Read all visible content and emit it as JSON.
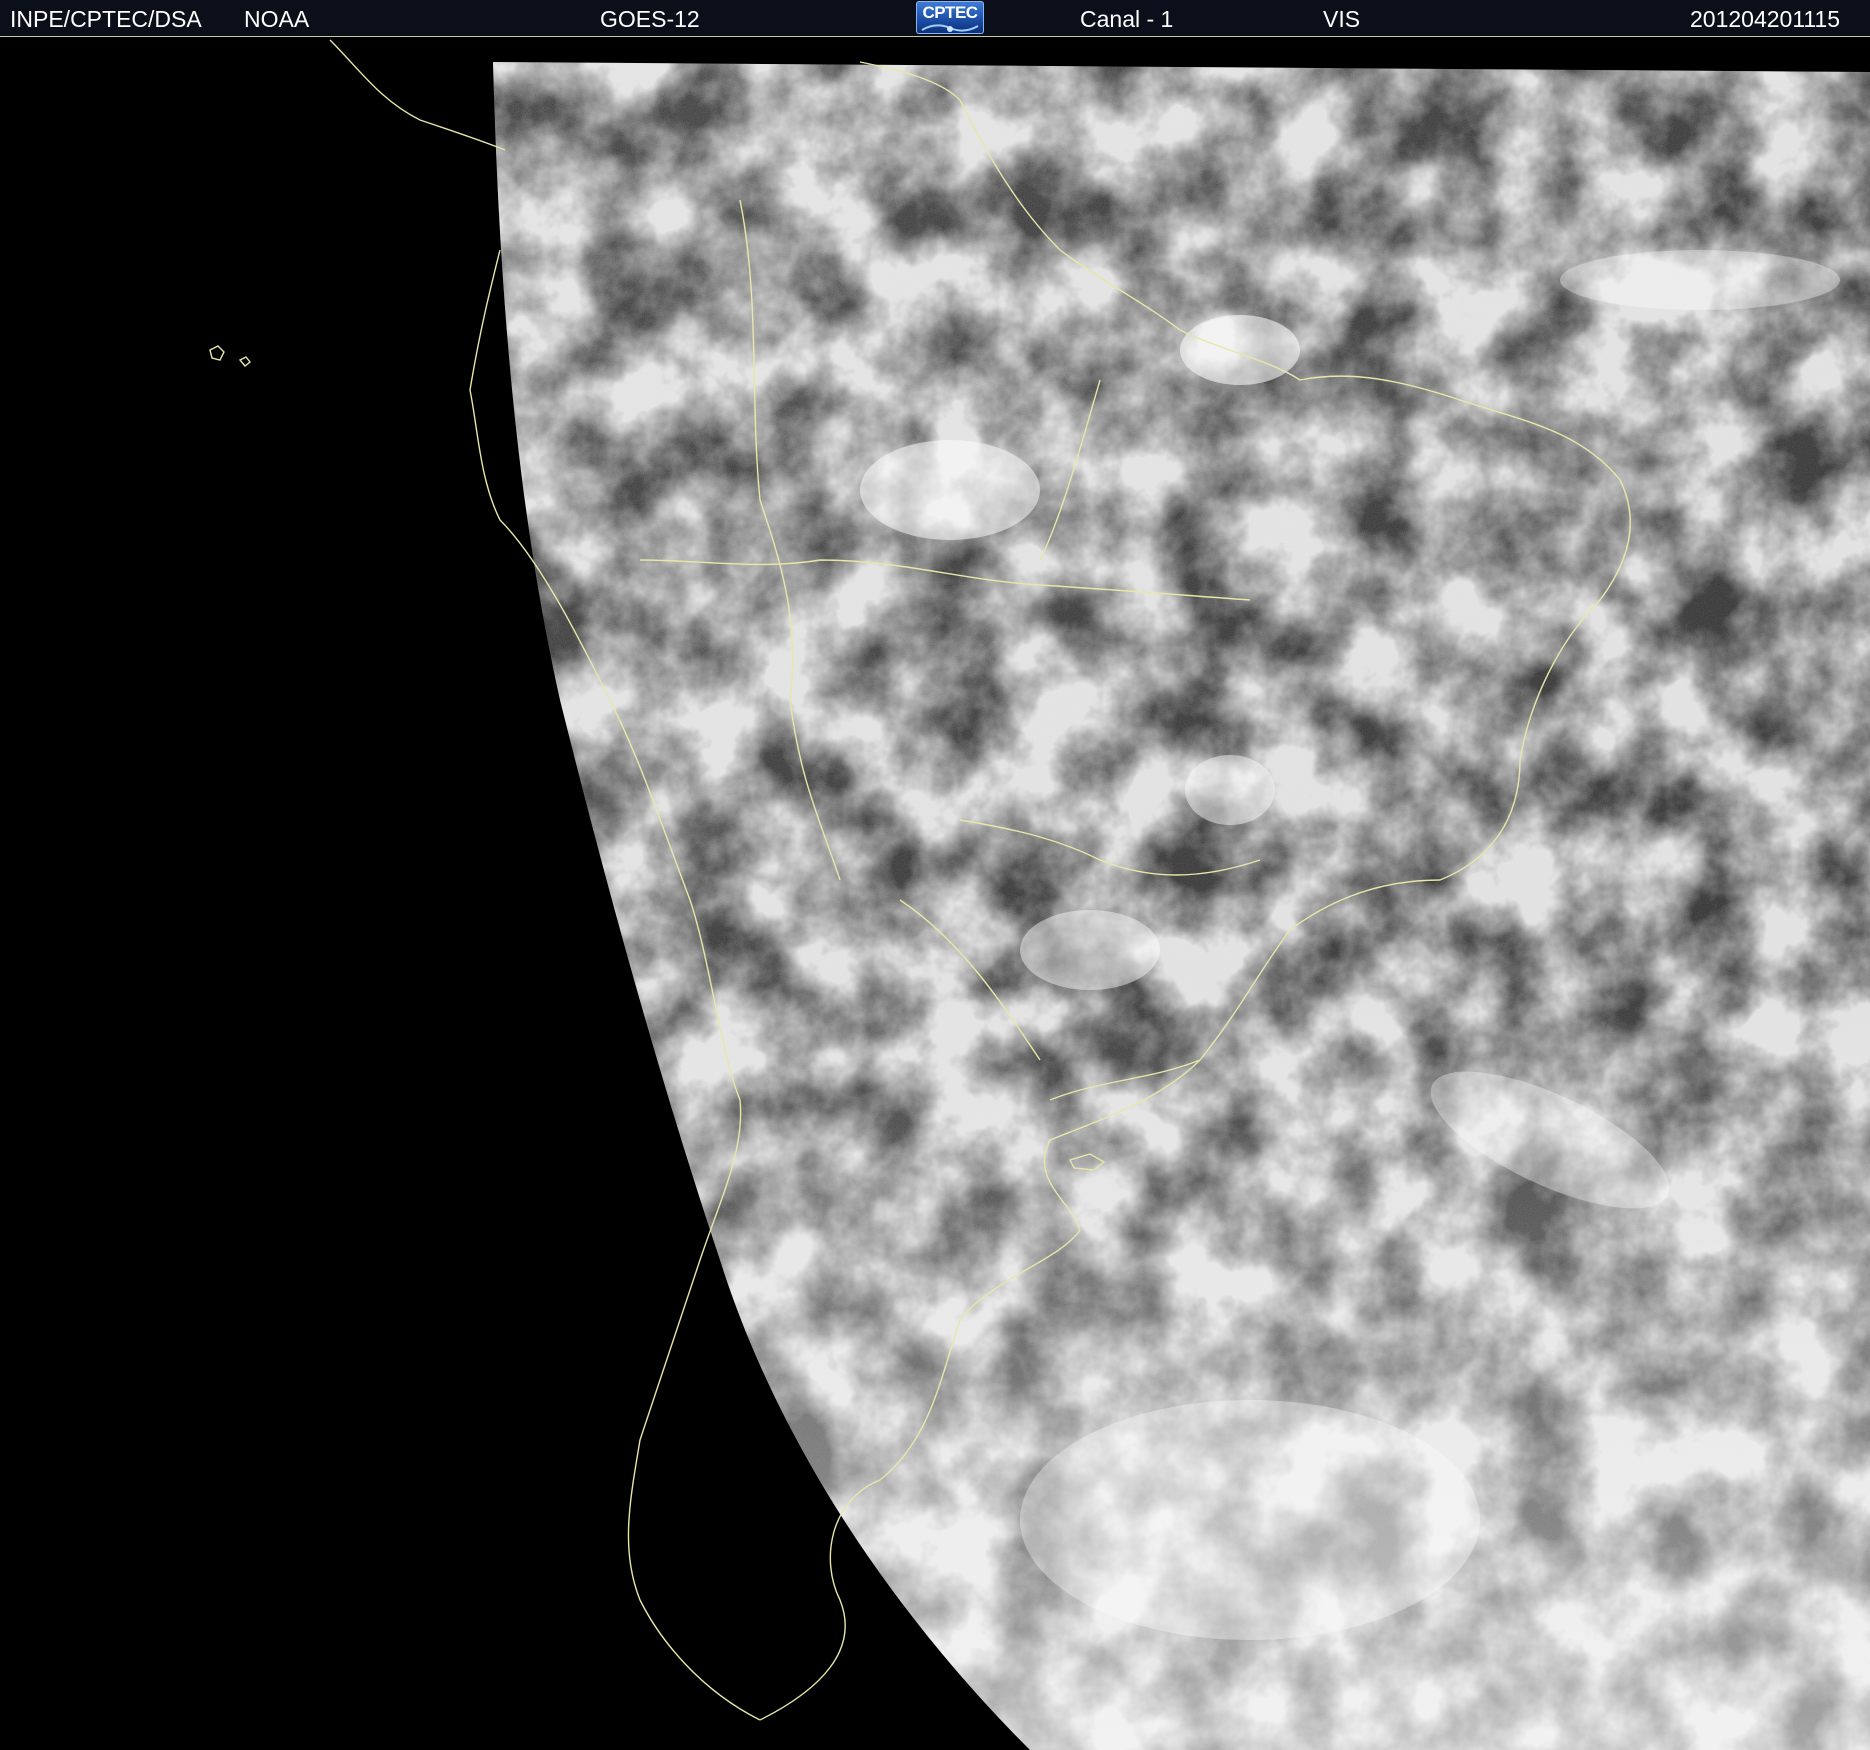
{
  "header": {
    "source": "INPE/CPTEC/DSA",
    "agency": "NOAA",
    "satellite": "GOES-12",
    "logo_text": "CPTEC",
    "channel": "Canal - 1",
    "band": "VIS",
    "timestamp": "201204201115"
  },
  "image": {
    "type": "satellite-visible-imagery",
    "background_color": "#000000",
    "coastline_color": "#e8e6a8"
  }
}
